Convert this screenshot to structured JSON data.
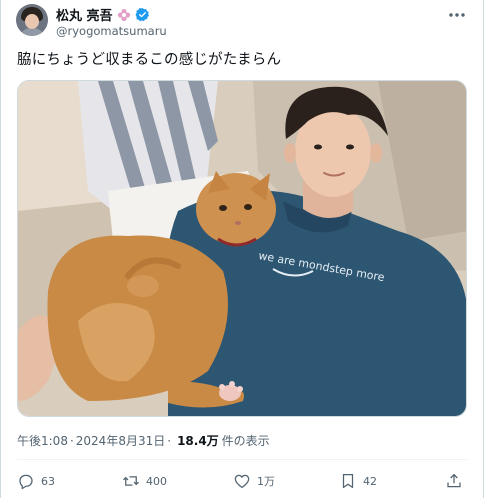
{
  "user": {
    "display_name": "松丸 亮吾",
    "handle": "@ryogomatsumaru",
    "verified": true,
    "accent_color": "#1d9bf0",
    "flower_color": "#e2a0c8"
  },
  "tweet": {
    "text": "脇にちょうど収まるこの感じがたまらん",
    "photo_caption": "we are mondstep more"
  },
  "meta": {
    "time": "午後1:08",
    "separator": "·",
    "date": "2024年8月31日",
    "views": "18.4万",
    "views_label": "件の表示"
  },
  "actions": {
    "replies": "63",
    "retweets": "400",
    "likes": "1万",
    "bookmarks": "42"
  },
  "icons": {
    "more": "more-icon",
    "reply": "reply-icon",
    "retweet": "retweet-icon",
    "like": "heart-icon",
    "bookmark": "bookmark-icon",
    "share": "share-icon"
  }
}
